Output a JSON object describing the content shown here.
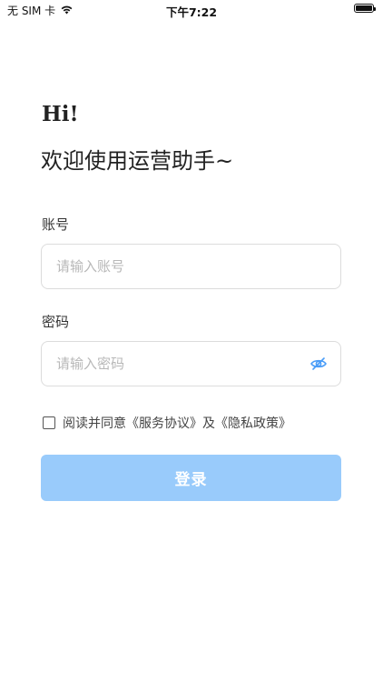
{
  "status_bar": {
    "carrier": "无 SIM 卡",
    "time": "下午7:22",
    "battery_percent": 100
  },
  "header": {
    "greeting": "Hi!",
    "welcome": "欢迎使用运营助手~"
  },
  "form": {
    "account_label": "账号",
    "account_placeholder": "请输入账号",
    "password_label": "密码",
    "password_placeholder": "请输入密码"
  },
  "agreement": {
    "prefix": "阅读并同意",
    "service_link": "《服务协议》",
    "conjunction": "及",
    "privacy_link": "《隐私政策》"
  },
  "login_button_label": "登录",
  "colors": {
    "accent": "#99cbfb",
    "icon_blue": "#4a9df8"
  },
  "icons": {
    "wifi": "wifi-icon",
    "battery": "battery-icon",
    "eye_toggle": "eye-off-icon",
    "checkbox": "checkbox-icon"
  }
}
